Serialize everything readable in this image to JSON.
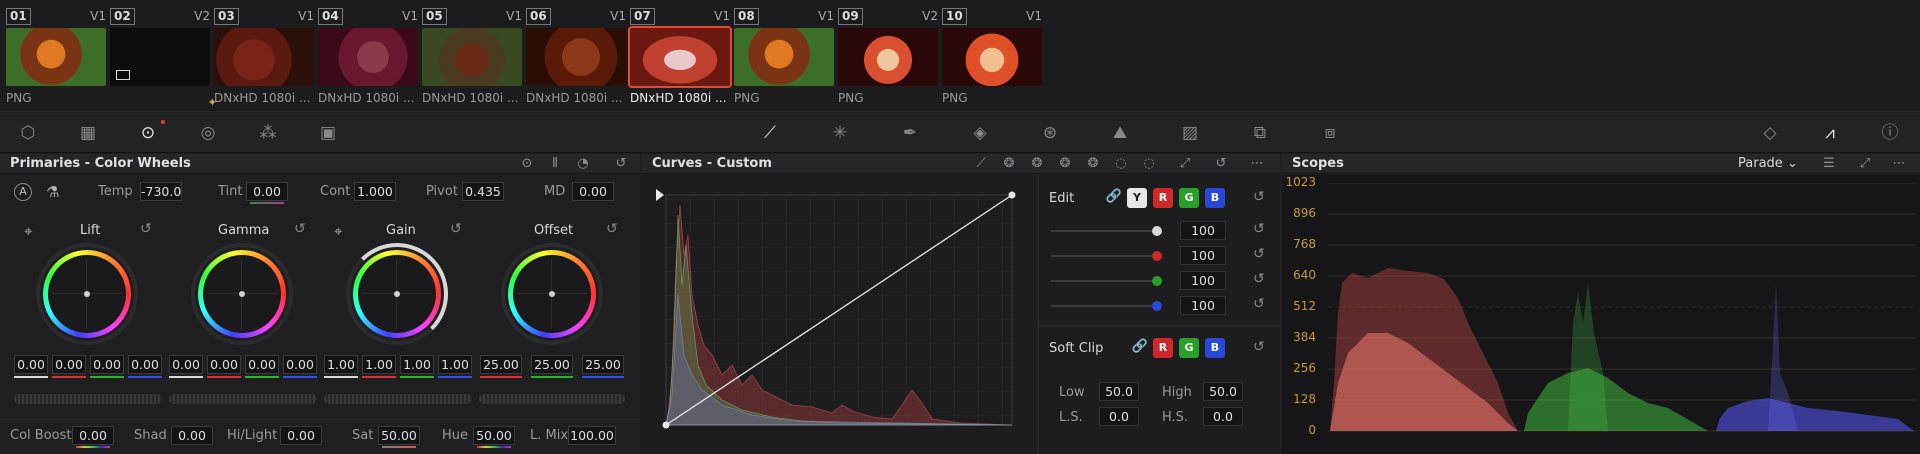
{
  "clips": [
    {
      "num": "01",
      "ver": "V1",
      "name": "PNG",
      "colors": [
        "#7a3414",
        "#3d6e28",
        "#e07a22"
      ]
    },
    {
      "num": "02",
      "ver": "V2",
      "name": "",
      "colors": [
        "#0c0c0c",
        "#0c0c0c",
        "#141414"
      ]
    },
    {
      "num": "03",
      "ver": "V1",
      "name": "DNxHD 1080i ...",
      "colors": [
        "#5a1a10",
        "#7a2418",
        "#2a1008"
      ]
    },
    {
      "num": "04",
      "ver": "V1",
      "name": "DNxHD 1080i ...",
      "colors": [
        "#6a1830",
        "#3a0a18",
        "#8a3a48"
      ]
    },
    {
      "num": "05",
      "ver": "V1",
      "name": "DNxHD 1080i ...",
      "colors": [
        "#4a3a20",
        "#6a2a18",
        "#3a4a20"
      ]
    },
    {
      "num": "06",
      "ver": "V1",
      "name": "DNxHD 1080i ...",
      "colors": [
        "#5a1a08",
        "#8a3818",
        "#2a0e06"
      ]
    },
    {
      "num": "07",
      "ver": "V1",
      "name": "DNxHD 1080i ...",
      "colors": [
        "#c04030",
        "#e8c8c8",
        "#6a1810"
      ]
    },
    {
      "num": "08",
      "ver": "V1",
      "name": "PNG",
      "colors": [
        "#7a3414",
        "#3d6e28",
        "#e07a22"
      ]
    },
    {
      "num": "09",
      "ver": "V2",
      "name": "PNG",
      "colors": [
        "#2a0808",
        "#d85030",
        "#f0c8a0"
      ]
    },
    {
      "num": "10",
      "ver": "V1",
      "name": "PNG",
      "colors": [
        "#2a0808",
        "#e05028",
        "#f0c090"
      ]
    }
  ],
  "primaries": {
    "title": "Primaries - Color Wheels",
    "auto_label": "A",
    "temp_label": "Temp",
    "temp": "-730.0",
    "tint_label": "Tint",
    "tint": "0.00",
    "cont_label": "Cont",
    "cont": "1.000",
    "pivot_label": "Pivot",
    "pivot": "0.435",
    "md_label": "MD",
    "md": "0.00",
    "wheels": [
      {
        "label": "Lift",
        "values": [
          "0.00",
          "0.00",
          "0.00",
          "0.00"
        ]
      },
      {
        "label": "Gamma",
        "values": [
          "0.00",
          "0.00",
          "0.00",
          "0.00"
        ]
      },
      {
        "label": "Gain",
        "values": [
          "1.00",
          "1.00",
          "1.00",
          "1.00"
        ]
      },
      {
        "label": "Offset",
        "values": [
          "25.00",
          "25.00",
          "25.00"
        ]
      }
    ],
    "colboost_label": "Col Boost",
    "colboost": "0.00",
    "shad_label": "Shad",
    "shad": "0.00",
    "hilight_label": "Hi/Light",
    "hilight": "0.00",
    "sat_label": "Sat",
    "sat": "50.00",
    "hue_label": "Hue",
    "hue": "50.00",
    "lmix_label": "L. Mix",
    "lmix": "100.00"
  },
  "curves": {
    "title": "Curves - Custom"
  },
  "edit": {
    "label": "Edit",
    "channels": [
      "Y",
      "R",
      "G",
      "B"
    ],
    "values": [
      "100",
      "100",
      "100",
      "100"
    ],
    "softclip_label": "Soft Clip",
    "softclip_channels": [
      "R",
      "G",
      "B"
    ],
    "low_label": "Low",
    "low": "50.0",
    "high_label": "High",
    "high": "50.0",
    "ls_label": "L.S.",
    "ls": "0.0",
    "hs_label": "H.S.",
    "hs": "0.0"
  },
  "scopes": {
    "title": "Scopes",
    "mode": "Parade",
    "scale": [
      "1023",
      "896",
      "768",
      "640",
      "512",
      "384",
      "256",
      "128",
      "0"
    ]
  }
}
